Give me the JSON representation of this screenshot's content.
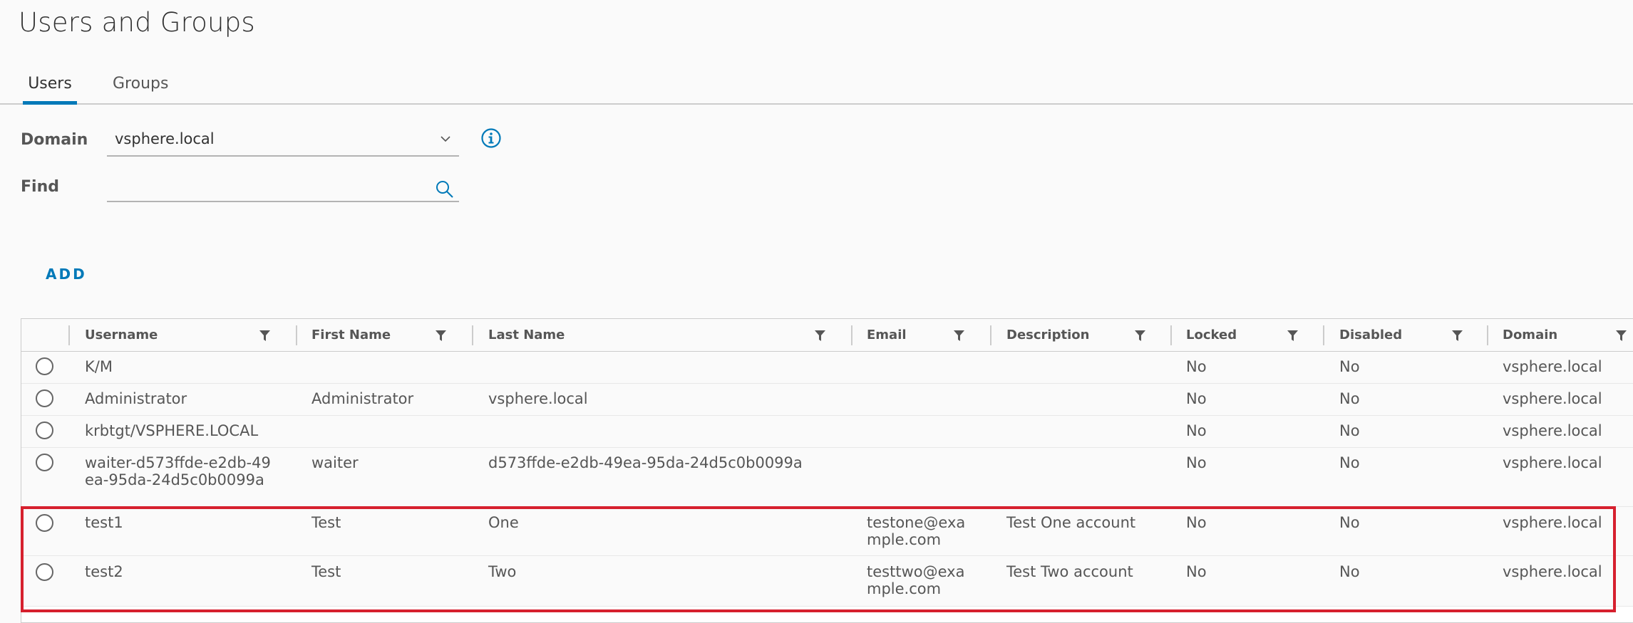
{
  "page": {
    "title": "Users and Groups"
  },
  "tabs": [
    {
      "label": "Users",
      "active": true
    },
    {
      "label": "Groups",
      "active": false
    }
  ],
  "form": {
    "domain_label": "Domain",
    "domain_value": "vsphere.local",
    "find_label": "Find",
    "find_value": "",
    "find_placeholder": ""
  },
  "toolbar": {
    "add_label": "ADD"
  },
  "grid": {
    "columns": [
      "Username",
      "First Name",
      "Last Name",
      "Email",
      "Description",
      "Locked",
      "Disabled",
      "Domain"
    ],
    "rows": [
      {
        "username": "K/M",
        "first_name": "",
        "last_name": "",
        "email": "",
        "description": "",
        "locked": "No",
        "disabled": "No",
        "domain": "vsphere.local"
      },
      {
        "username": "Administrator",
        "first_name": "Administrator",
        "last_name": "vsphere.local",
        "email": "",
        "description": "",
        "locked": "No",
        "disabled": "No",
        "domain": "vsphere.local"
      },
      {
        "username": "krbtgt/VSPHERE.LOCAL",
        "first_name": "",
        "last_name": "",
        "email": "",
        "description": "",
        "locked": "No",
        "disabled": "No",
        "domain": "vsphere.local"
      },
      {
        "username": "waiter-d573ffde-e2db-49ea-95da-24d5c0b0099a",
        "first_name": "waiter",
        "last_name": "d573ffde-e2db-49ea-95da-24d5c0b0099a",
        "email": "",
        "description": "",
        "locked": "No",
        "disabled": "No",
        "domain": "vsphere.local"
      },
      {
        "username": "test1",
        "first_name": "Test",
        "last_name": "One",
        "email": "testone@example.com",
        "description": "Test One account",
        "locked": "No",
        "disabled": "No",
        "domain": "vsphere.local"
      },
      {
        "username": "test2",
        "first_name": "Test",
        "last_name": "Two",
        "email": "testtwo@example.com",
        "description": "Test Two account",
        "locked": "No",
        "disabled": "No",
        "domain": "vsphere.local"
      }
    ]
  },
  "colors": {
    "accent": "#0079b8",
    "highlight": "#d6202e",
    "border": "#cccccc"
  },
  "icons": [
    "chevron-down-icon",
    "info-icon",
    "search-icon",
    "filter-icon"
  ]
}
